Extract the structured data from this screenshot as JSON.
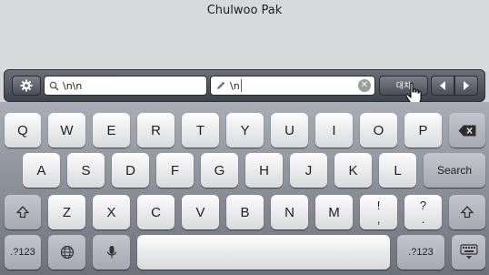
{
  "document": {
    "title": "Chulwoo Pak"
  },
  "findbar": {
    "find_value": "\\n\\n",
    "replace_value": "\\n",
    "replace_label": "대치"
  },
  "keyboard": {
    "row1": [
      "Q",
      "W",
      "E",
      "R",
      "T",
      "Y",
      "U",
      "I",
      "O",
      "P"
    ],
    "row2": [
      "A",
      "S",
      "D",
      "F",
      "G",
      "H",
      "J",
      "K",
      "L"
    ],
    "row2_action": "Search",
    "row3": [
      "Z",
      "X",
      "C",
      "V",
      "B",
      "N",
      "M"
    ],
    "row3_punct": [
      {
        "top": "!",
        "bottom": ","
      },
      {
        "top": "?",
        "bottom": "."
      }
    ],
    "numbers_label": ".?123"
  },
  "colors": {
    "caret": "#3562d7",
    "bar_top": "#6d7079",
    "bar_bottom": "#3e424b"
  }
}
